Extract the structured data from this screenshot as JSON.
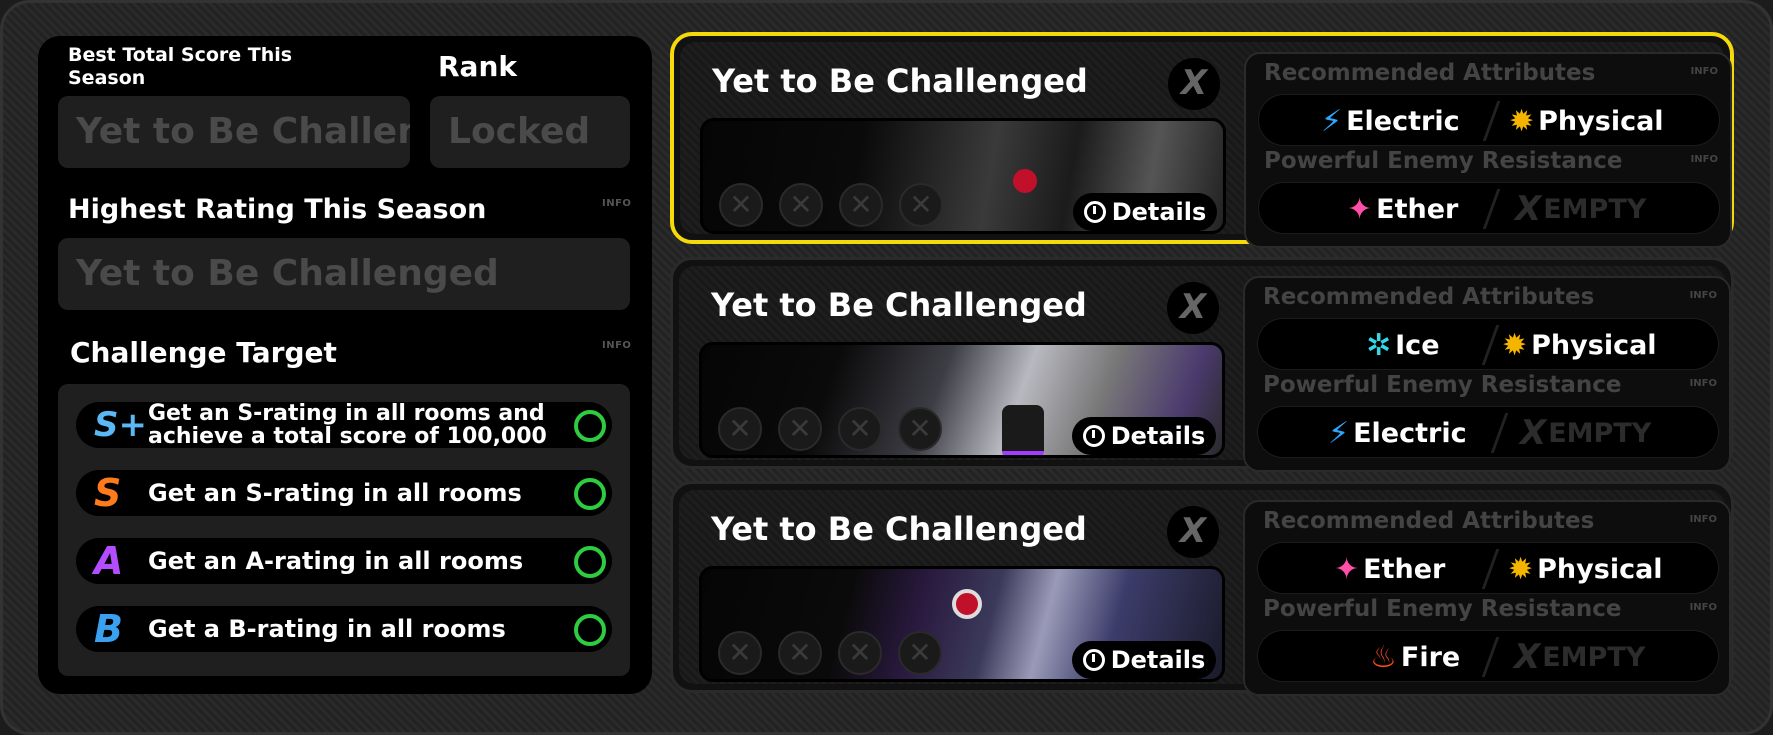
{
  "summary": {
    "best_total_label": "Best Total Score This Season",
    "best_total_value": "Yet to Be Challenged",
    "rank_label": "Rank",
    "rank_value": "Locked",
    "highest_rating_label": "Highest Rating This Season",
    "highest_rating_value": "Yet to Be Challenged",
    "info_label": "INFO",
    "challenge_target_label": "Challenge Target"
  },
  "targets": [
    {
      "badge": "S+",
      "text_line1": "Get an S-rating in all rooms and",
      "text_line2": "achieve a total score of 100,000",
      "badge_color": "#5ab8f5"
    },
    {
      "badge": "S",
      "text_line1": "Get an S-rating in all rooms",
      "text_line2": "",
      "badge_color": "#ff7a1a"
    },
    {
      "badge": "A",
      "text_line1": "Get an A-rating in all rooms",
      "text_line2": "",
      "badge_color": "#b34dff"
    },
    {
      "badge": "B",
      "text_line1": "Get a B-rating in all rooms",
      "text_line2": "",
      "badge_color": "#3aa0f0"
    }
  ],
  "rooms": [
    {
      "title": "Yet to Be Challenged",
      "close": "X",
      "details": "Details",
      "selected": true,
      "recommended_label": "Recommended Attributes",
      "resistance_label": "Powerful Enemy Resistance",
      "info": "INFO",
      "recommended": [
        {
          "name": "Electric",
          "icon": "electric-icon",
          "color": "#2aa8ff"
        },
        {
          "name": "Physical",
          "icon": "physical-icon",
          "color": "#f5b400"
        }
      ],
      "resistance": [
        {
          "name": "Ether",
          "icon": "ether-icon",
          "color": "#ff4fa8"
        },
        {
          "name": "EMPTY",
          "icon": "empty-icon",
          "color": "#2c2c2c"
        }
      ]
    },
    {
      "title": "Yet to Be Challenged",
      "close": "X",
      "details": "Details",
      "selected": false,
      "recommended_label": "Recommended Attributes",
      "resistance_label": "Powerful Enemy Resistance",
      "info": "INFO",
      "recommended": [
        {
          "name": "Ice",
          "icon": "ice-icon",
          "color": "#35d6e8"
        },
        {
          "name": "Physical",
          "icon": "physical-icon",
          "color": "#f5b400"
        }
      ],
      "resistance": [
        {
          "name": "Electric",
          "icon": "electric-icon",
          "color": "#2aa8ff"
        },
        {
          "name": "EMPTY",
          "icon": "empty-icon",
          "color": "#2c2c2c"
        }
      ]
    },
    {
      "title": "Yet to Be Challenged",
      "close": "X",
      "details": "Details",
      "selected": false,
      "recommended_label": "Recommended Attributes",
      "resistance_label": "Powerful Enemy Resistance",
      "info": "INFO",
      "recommended": [
        {
          "name": "Ether",
          "icon": "ether-icon",
          "color": "#ff4fa8"
        },
        {
          "name": "Physical",
          "icon": "physical-icon",
          "color": "#f5b400"
        }
      ],
      "resistance": [
        {
          "name": "Fire",
          "icon": "fire-icon",
          "color": "#ff4a1a"
        },
        {
          "name": "EMPTY",
          "icon": "empty-icon",
          "color": "#2c2c2c"
        }
      ]
    }
  ],
  "colors": {
    "selected_border": "#f5d90a",
    "target_circle": "#2ecc40"
  }
}
